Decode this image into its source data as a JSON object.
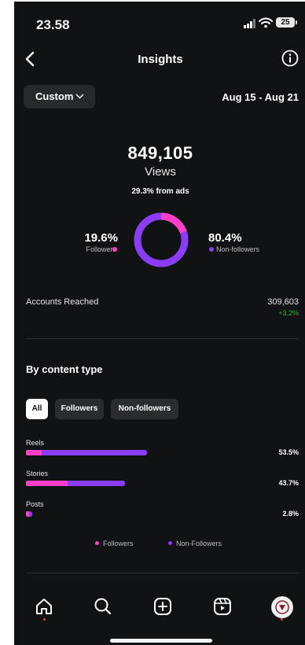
{
  "status": {
    "time": "23.58",
    "battery": "25"
  },
  "header": {
    "title": "Insights"
  },
  "filter": {
    "range_label": "Custom",
    "date_range": "Aug 15 - Aug 21"
  },
  "summary": {
    "views_value": "849,105",
    "views_label": "Views",
    "ads_note": "29.3% from ads",
    "followers_pct": "19.6%",
    "followers_label": "Followers",
    "followers_fraction": 0.196,
    "nonfollowers_pct": "80.4%",
    "nonfollowers_label": "Non-followers"
  },
  "reach": {
    "label": "Accounts Reached",
    "value": "309,603",
    "change": "+3.2%"
  },
  "content": {
    "title": "By content type",
    "tabs": [
      "All",
      "Followers",
      "Non-followers"
    ],
    "rows": [
      {
        "label": "Reels",
        "pct": "53.5%",
        "followers": 0.13,
        "nonfollowers": 0.87
      },
      {
        "label": "Stories",
        "pct": "43.7%",
        "followers": 0.42,
        "nonfollowers": 0.58
      },
      {
        "label": "Posts",
        "pct": "2.8%",
        "followers": 0.55,
        "nonfollowers": 0.45
      }
    ],
    "legend_followers": "Followers",
    "legend_nonfollowers": "Non-Followers"
  },
  "colors": {
    "followers": "#ff3fc7",
    "nonfollowers": "#8a3df5",
    "positive": "#39b54a"
  },
  "nav": {
    "icons": [
      "home-icon",
      "search-icon",
      "create-icon",
      "reels-icon",
      "profile-avatar"
    ]
  }
}
